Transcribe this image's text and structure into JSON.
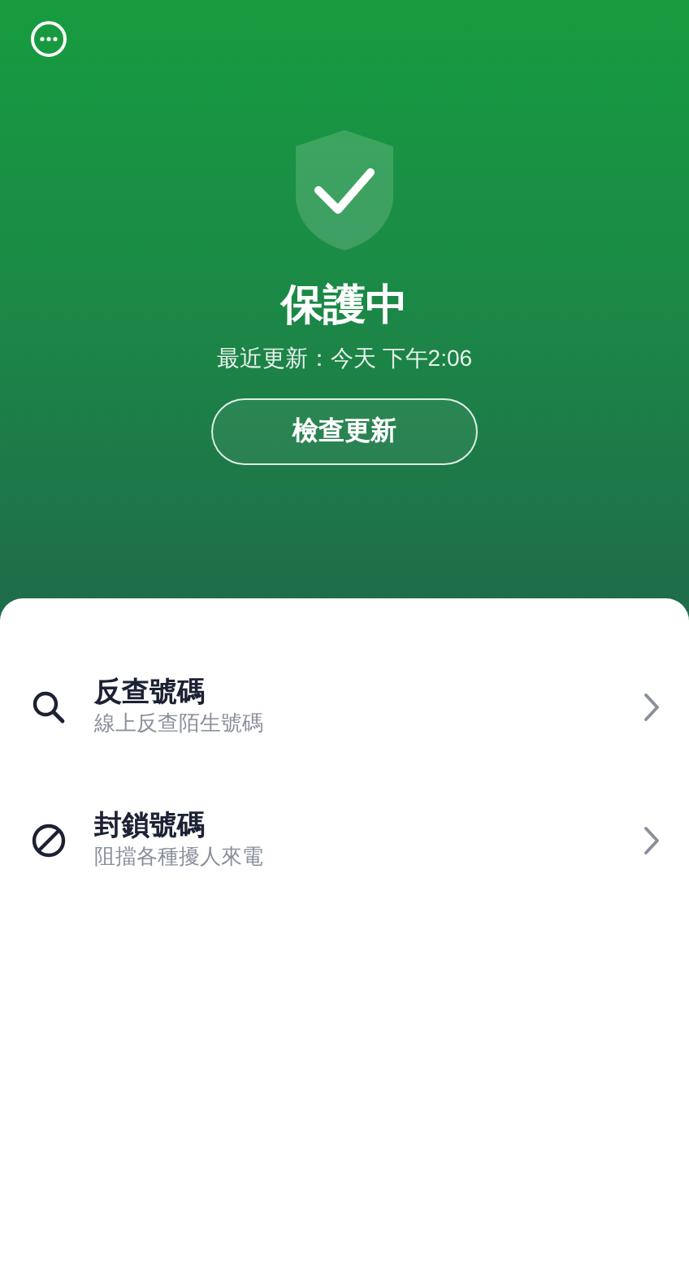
{
  "header": {
    "status_title": "保護中",
    "last_update": "最近更新：今天 下午2:06",
    "check_button": "檢查更新"
  },
  "features": [
    {
      "kind": "search",
      "title": "反查號碼",
      "subtitle": "線上反查陌生號碼"
    },
    {
      "kind": "block",
      "title": "封鎖號碼",
      "subtitle": "阻擋各種擾人來電"
    }
  ]
}
